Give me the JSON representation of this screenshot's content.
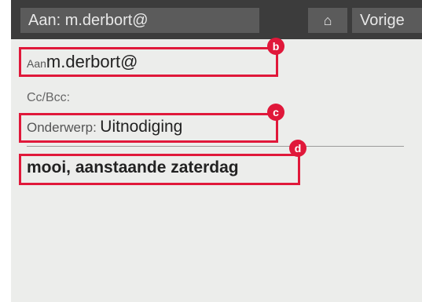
{
  "header": {
    "title": "Aan: m.derbort@",
    "home_icon": "⌂",
    "prev_label": "Vorige"
  },
  "compose": {
    "to_label": "Aan",
    "to_value": "m.derbort@",
    "cc_label": "Cc/Bcc:",
    "subject_label": "Onderwerp:",
    "subject_value": "Uitnodiging",
    "body_text": "mooi, aanstaande zaterdag"
  },
  "callouts": {
    "b": "b",
    "c": "c",
    "d": "d",
    "color": "#e0183a"
  }
}
